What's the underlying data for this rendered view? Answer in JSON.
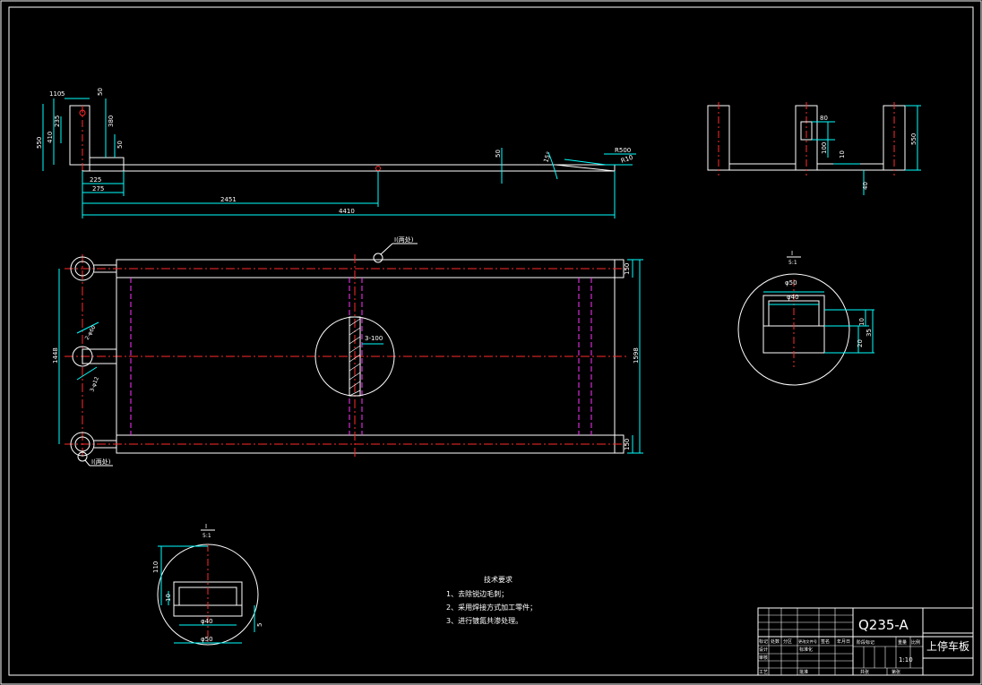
{
  "drawing": {
    "colors": {
      "background": "#000000",
      "outline": "#ffffff",
      "dimension": "#00ffff",
      "centerline": "#ff2a2a",
      "hidden": "#ff33ff",
      "hatch": "#ffffff"
    },
    "top_view": {
      "dims": [
        "110",
        "5",
        "50",
        "235",
        "410",
        "550",
        "380",
        "50",
        "225",
        "275",
        "2451",
        "4410",
        "50",
        "15°",
        "R500",
        "R10"
      ]
    },
    "end_view": {
      "dims": [
        "80",
        "100",
        "10",
        "550",
        "40"
      ]
    },
    "plan_view": {
      "dims": [
        "150",
        "1448",
        "1598",
        "150",
        "3-100",
        "2-φ60",
        "3-φ12"
      ],
      "callout_top": "I(两处)",
      "callout_bottom": "I(两处)"
    },
    "detail_right": {
      "label": "I",
      "scale": "5:1",
      "dims": [
        "φ50",
        "φ40",
        "10",
        "35",
        "20"
      ]
    },
    "detail_left": {
      "label": "I",
      "scale": "5:1",
      "dims": [
        "110",
        "10",
        "φ40",
        "φ50",
        "5"
      ]
    },
    "notes": {
      "title": "技术要求",
      "items": [
        "1、去除锐边毛刺；",
        "2、采用焊接方式加工零件；",
        "3、进行镀氮共渗处理。"
      ]
    },
    "title_block": {
      "material": "Q235-A",
      "part_name": "上停车板",
      "scale": "1:10",
      "row_labels": [
        "标记",
        "处数",
        "分区",
        "更改文件号",
        "签名",
        "年月日"
      ],
      "left_labels": [
        "设计",
        "审核",
        "工艺"
      ],
      "mid_labels": [
        "标准化",
        "批准"
      ],
      "right_labels": [
        "阶段标记",
        "重量",
        "比例"
      ],
      "sheet_labels": [
        "共张",
        "第张"
      ]
    }
  }
}
